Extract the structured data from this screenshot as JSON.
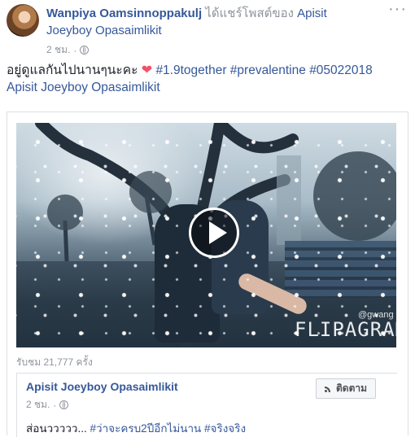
{
  "post": {
    "author": "Wanpiya Oamsinnoppakulj",
    "shared_text": "ได้แชร์โพสต์ของ",
    "shared_from": "Apisit",
    "shared_from_cont": "Joeyboy Opasaimlikit",
    "time": "2 ชม.",
    "separator": "·",
    "more_icon": "more-options-icon",
    "text_prefix": "อยู่ดูแลกันไปนานๆนะคะ",
    "heart": "❤",
    "hashtags": [
      "#1.9together",
      "#prevalentine",
      "#05022018"
    ],
    "mention": "Apisit Joeyboy Opasaimlikit"
  },
  "shared": {
    "watermark": "FLIPAGRAM",
    "watermark_handle": "@gwang",
    "views": "รับชม 21,777 ครั้ง",
    "inner_author": "Apisit Joeyboy Opasaimlikit",
    "inner_time": "2 ชม.",
    "separator": "·",
    "follow_label": "ติดตาม",
    "inner_text_prefix": "ส่อนววววว...",
    "inner_hashtags": [
      "#ว่าจะครบ2ปีอีกไม่นาน",
      "#จริงจริง"
    ]
  },
  "colors": {
    "link": "#365899",
    "meta": "#90949c",
    "heart": "#f25268"
  }
}
